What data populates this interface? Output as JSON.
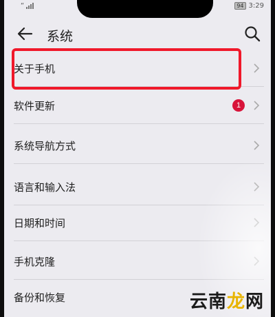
{
  "status_bar": {
    "left_glyph": "“",
    "battery": "94",
    "time": "3:29"
  },
  "header": {
    "title": "系统"
  },
  "settings": {
    "items": [
      {
        "label": "关于手机"
      },
      {
        "label": "软件更新",
        "badge": "1"
      },
      {
        "label": "系统导航方式"
      },
      {
        "label": "语言和输入法"
      },
      {
        "label": "日期和时间"
      },
      {
        "label": "手机克隆"
      },
      {
        "label": "备份和恢复"
      }
    ]
  },
  "watermark": {
    "part1": "云南",
    "part2": "龙",
    "part3": "网"
  },
  "colors": {
    "highlight": "#f0182a",
    "badge": "#d8143a",
    "screen_background": "#ecebf0"
  }
}
